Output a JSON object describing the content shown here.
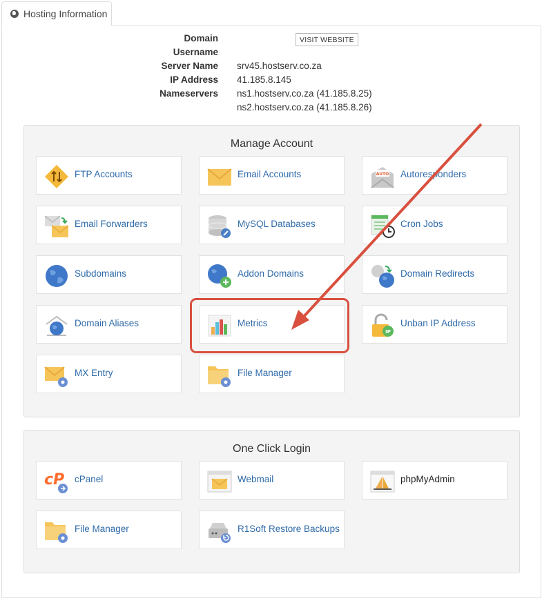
{
  "tab": {
    "label": "Hosting Information",
    "icon": "globe-icon"
  },
  "info": {
    "domain_label": "Domain",
    "username_label": "Username",
    "server_name_label": "Server Name",
    "server_name_value": "srv45.hostserv.co.za",
    "ip_label": "IP Address",
    "ip_value": "41.185.8.145",
    "nameservers_label": "Nameservers",
    "ns1": "ns1.hostserv.co.za (41.185.8.25)",
    "ns2": "ns2.hostserv.co.za (41.185.8.26)",
    "visit_button": "VISIT WEBSITE"
  },
  "manage": {
    "title": "Manage Account",
    "items": [
      {
        "label": "FTP Accounts",
        "icon": "ftp-icon"
      },
      {
        "label": "Email Accounts",
        "icon": "envelope-icon"
      },
      {
        "label": "Autoresponders",
        "icon": "autoresponder-icon"
      },
      {
        "label": "Email Forwarders",
        "icon": "email-forwarder-icon"
      },
      {
        "label": "MySQL Databases",
        "icon": "database-icon"
      },
      {
        "label": "Cron Jobs",
        "icon": "cron-icon"
      },
      {
        "label": "Subdomains",
        "icon": "globe-icon"
      },
      {
        "label": "Addon Domains",
        "icon": "globe-add-icon"
      },
      {
        "label": "Domain Redirects",
        "icon": "globe-redirect-icon"
      },
      {
        "label": "Domain Aliases",
        "icon": "domain-alias-icon"
      },
      {
        "label": "Metrics",
        "icon": "bar-chart-icon"
      },
      {
        "label": "Unban IP Address",
        "icon": "padlock-ip-icon"
      },
      {
        "label": "MX Entry",
        "icon": "mx-envelope-icon"
      },
      {
        "label": "File Manager",
        "icon": "folder-gear-icon"
      }
    ]
  },
  "oneclick": {
    "title": "One Click Login",
    "items": [
      {
        "label": "cPanel",
        "icon": "cpanel-icon"
      },
      {
        "label": "Webmail",
        "icon": "webmail-icon"
      },
      {
        "label": "phpMyAdmin",
        "icon": "phpmyadmin-icon"
      },
      {
        "label": "File Manager",
        "icon": "folder-gear-icon"
      },
      {
        "label": "R1Soft Restore Backups",
        "icon": "backup-drive-icon"
      }
    ]
  },
  "colors": {
    "link": "#2e6aa9",
    "highlight": "#d9503f",
    "section_bg": "#f4f4f4"
  }
}
